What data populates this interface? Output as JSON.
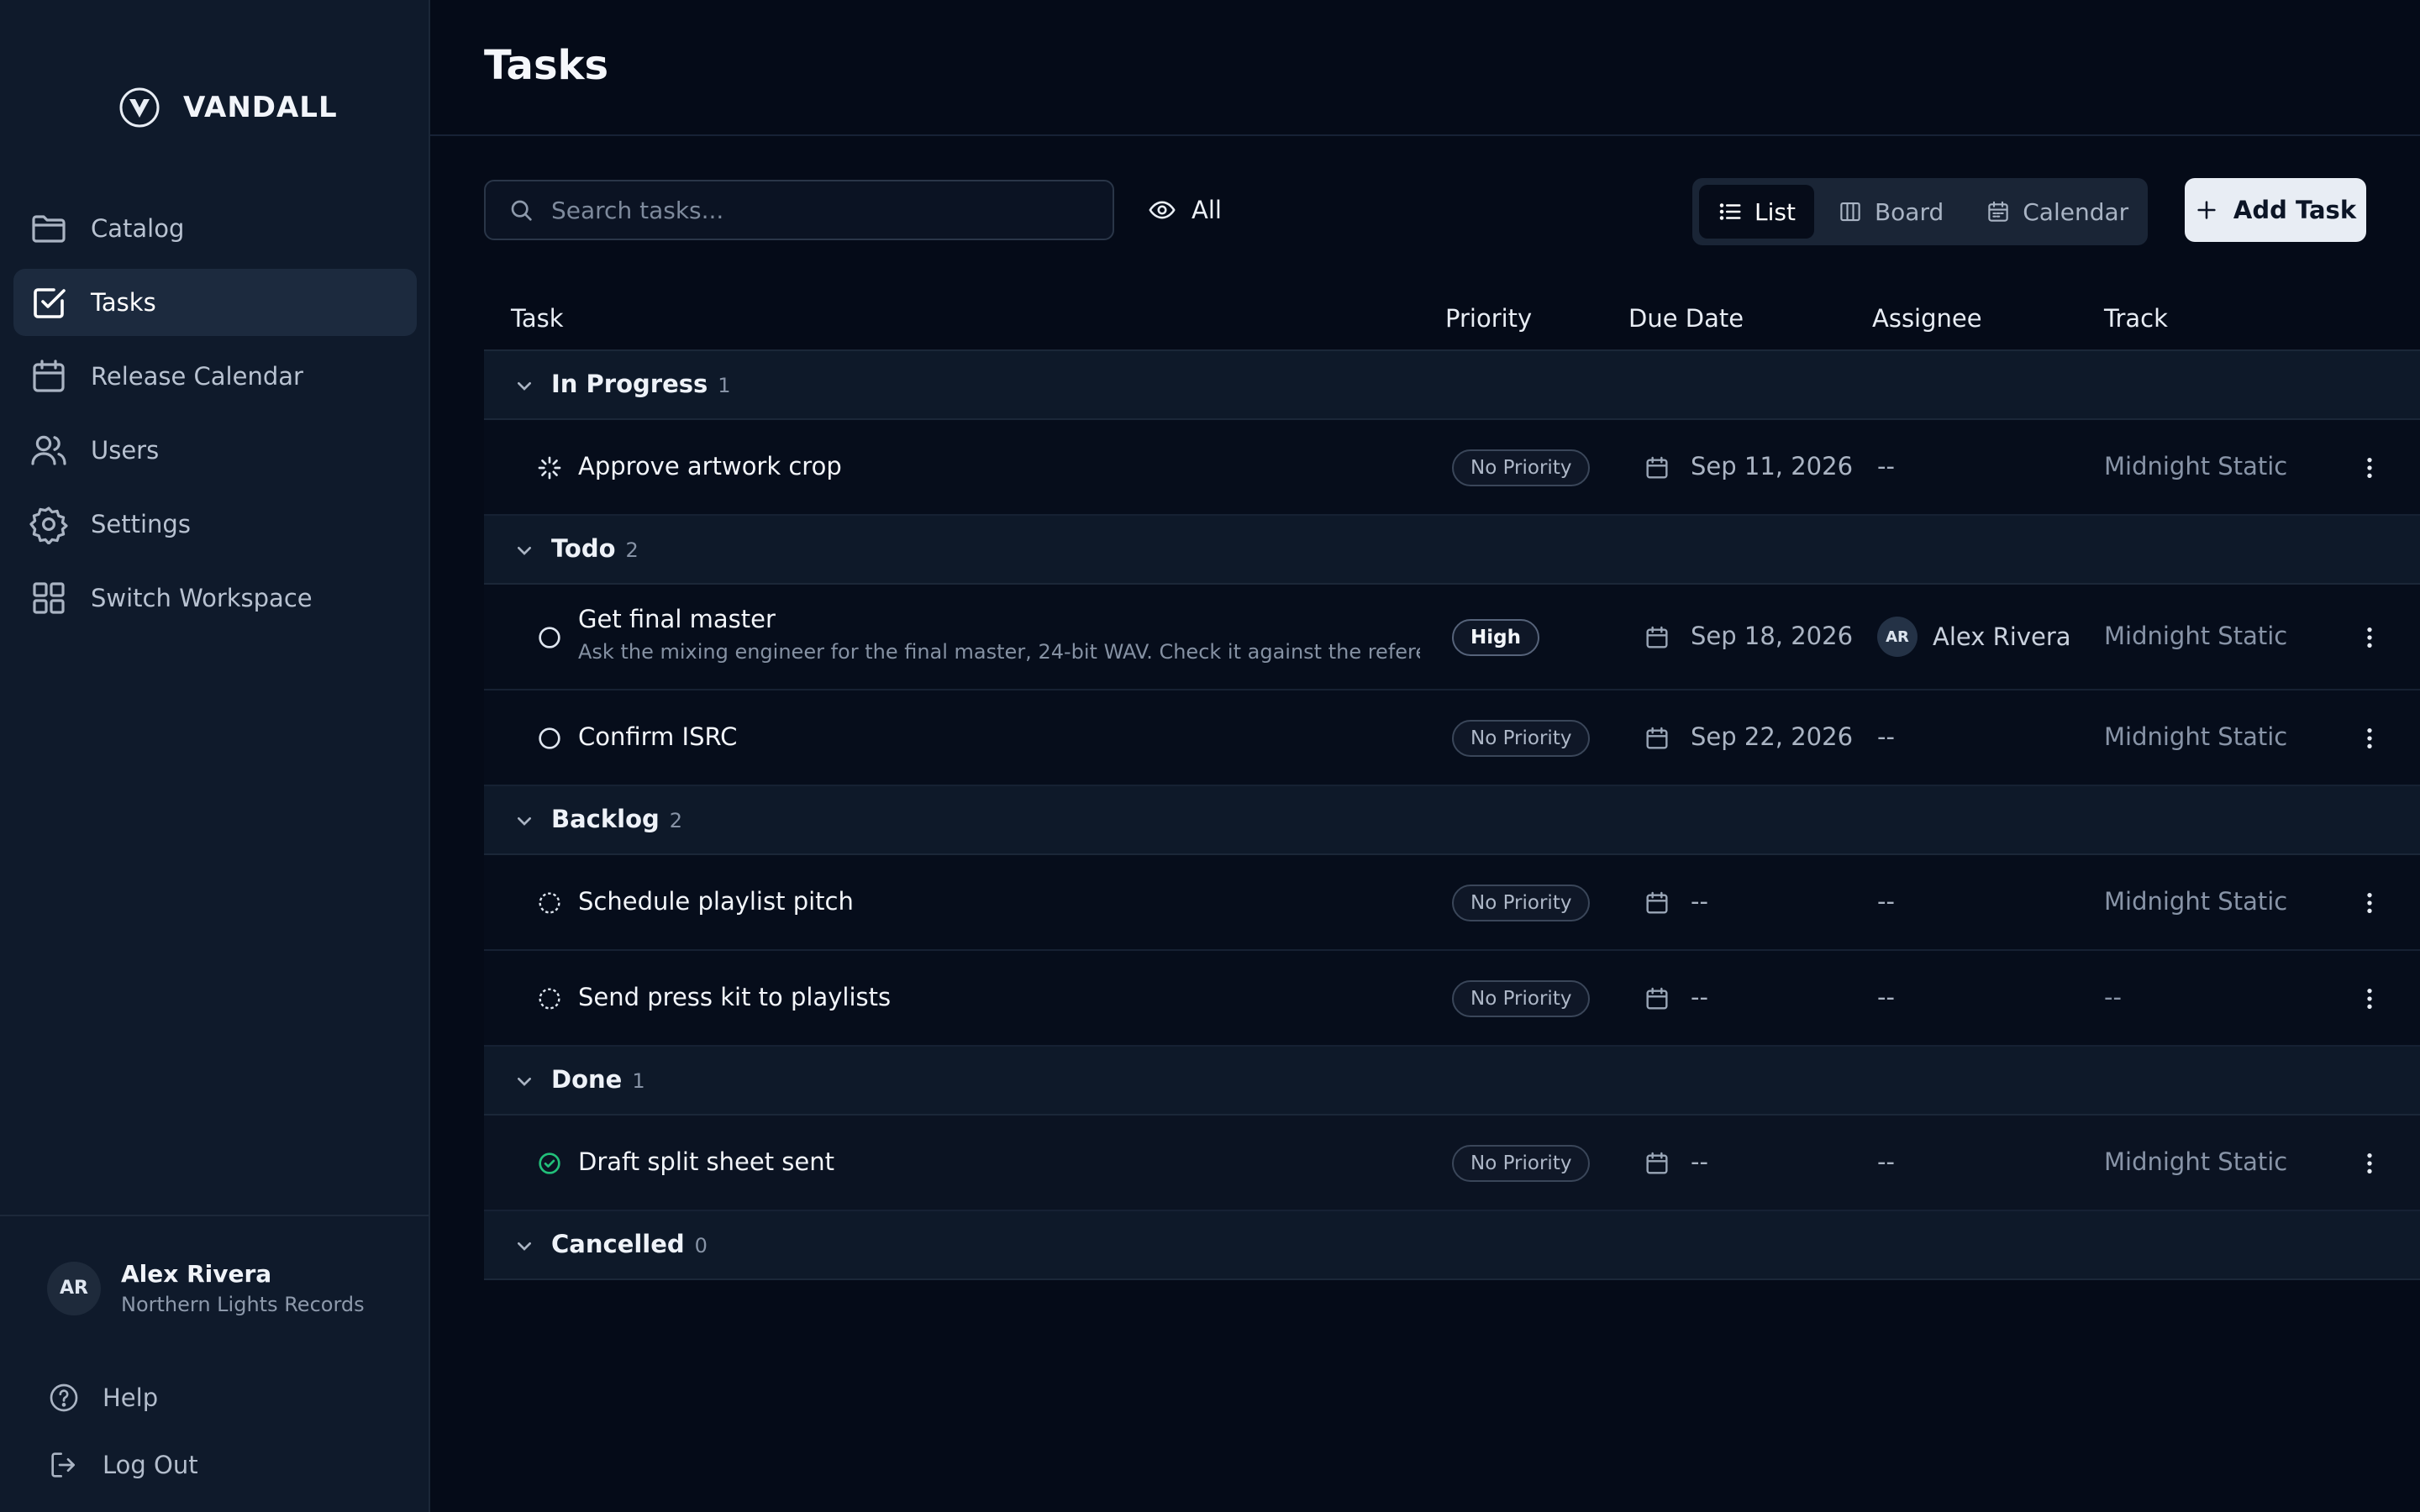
{
  "brand": {
    "name": "VANDALL"
  },
  "sidebar": {
    "items": [
      {
        "label": "Catalog",
        "icon": "folder-icon"
      },
      {
        "label": "Tasks",
        "icon": "checkbox-icon"
      },
      {
        "label": "Release Calendar",
        "icon": "calendar-icon"
      },
      {
        "label": "Users",
        "icon": "users-icon"
      },
      {
        "label": "Settings",
        "icon": "gear-icon"
      },
      {
        "label": "Switch Workspace",
        "icon": "grid-icon"
      }
    ],
    "user": {
      "initials": "AR",
      "name": "Alex Rivera",
      "org": "Northern Lights Records"
    },
    "help_label": "Help",
    "logout_label": "Log Out"
  },
  "page": {
    "title": "Tasks"
  },
  "toolbar": {
    "search_placeholder": "Search tasks...",
    "filter_label": "All",
    "views": [
      {
        "label": "List",
        "icon": "list-icon"
      },
      {
        "label": "Board",
        "icon": "board-icon"
      },
      {
        "label": "Calendar",
        "icon": "calendar-icon"
      }
    ],
    "add_label": "Add Task"
  },
  "table": {
    "columns": [
      "Task",
      "Priority",
      "Due Date",
      "Assignee",
      "Track"
    ],
    "groups": [
      {
        "label": "In Progress",
        "count": "1",
        "tasks": [
          {
            "title": "Approve artwork crop",
            "priority": "No Priority",
            "due": "Sep 11, 2026",
            "assignee": "--",
            "track": "Midnight Static"
          }
        ]
      },
      {
        "label": "Todo",
        "count": "2",
        "tasks": [
          {
            "title": "Get final master",
            "description": "Ask the mixing engineer for the final master, 24-bit WAV. Check it against the reference",
            "priority": "High",
            "due": "Sep 18, 2026",
            "assignee_initials": "AR",
            "assignee": "Alex Rivera",
            "track": "Midnight Static"
          },
          {
            "title": "Confirm ISRC",
            "priority": "No Priority",
            "due": "Sep 22, 2026",
            "assignee": "--",
            "track": "Midnight Static"
          }
        ]
      },
      {
        "label": "Backlog",
        "count": "2",
        "tasks": [
          {
            "title": "Schedule playlist pitch",
            "priority": "No Priority",
            "due": "--",
            "assignee": "--",
            "track": "Midnight Static"
          },
          {
            "title": "Send press kit to playlists",
            "priority": "No Priority",
            "due": "--",
            "assignee": "--",
            "track": "--"
          }
        ]
      },
      {
        "label": "Done",
        "count": "1",
        "tasks": [
          {
            "title": "Draft split sheet sent",
            "priority": "No Priority",
            "due": "--",
            "assignee": "--",
            "track": "Midnight Static"
          }
        ]
      },
      {
        "label": "Cancelled",
        "count": "0",
        "tasks": []
      }
    ]
  },
  "colors": {
    "background": "#050b18",
    "sidebar": "#0f1a2b",
    "done_status": "#22c07a"
  }
}
